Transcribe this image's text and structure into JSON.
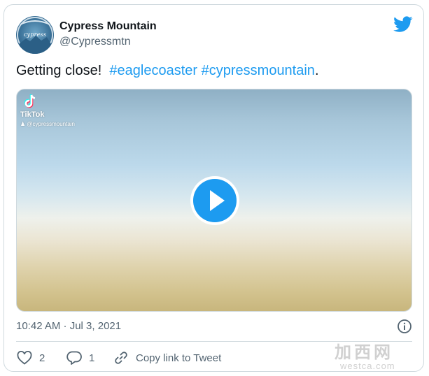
{
  "tweet": {
    "author_name": "Cypress Mountain",
    "author_handle": "@Cypressmtn",
    "avatar_logo_text": "cypress",
    "text_plain": "Getting close!  ",
    "hashtags": [
      "#eaglecoaster",
      "#cypressmountain"
    ],
    "text_end": ".",
    "timestamp": "10:42 AM · Jul 3, 2021"
  },
  "media": {
    "type": "video",
    "watermark_brand": "TikTok",
    "watermark_user": "@cypressmountain",
    "play_icon": "play-icon"
  },
  "actions": {
    "like_count": "2",
    "reply_count": "1",
    "copy_link_label": "Copy link to Tweet"
  },
  "icons": {
    "brand": "twitter-bird-icon",
    "info": "info-icon",
    "like": "heart-icon",
    "reply": "reply-icon",
    "copy": "link-icon"
  },
  "colors": {
    "accent": "#1d9bf0",
    "text_primary": "#0f1419",
    "text_secondary": "#536471",
    "border": "#cfd9de"
  },
  "site_watermark": {
    "cn": "加西网",
    "en": "westca.com"
  }
}
